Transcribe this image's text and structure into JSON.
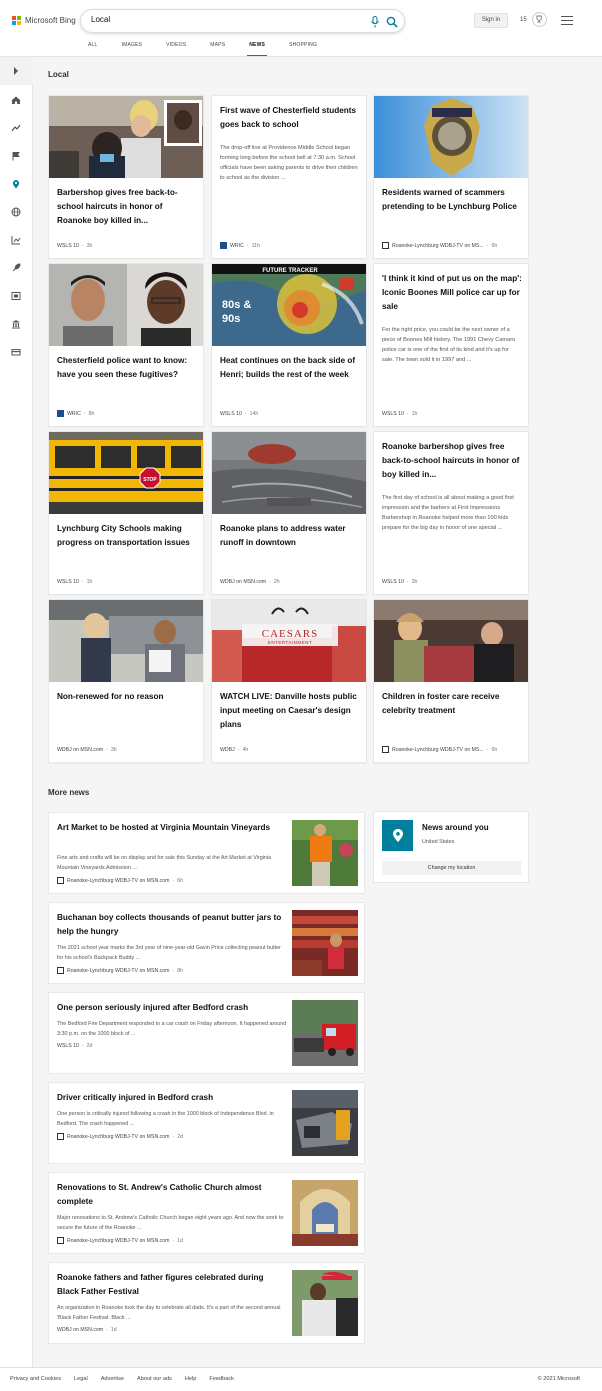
{
  "header": {
    "logo_text": "Microsoft Bing",
    "search_value": "Local",
    "signin_label": "Sign in",
    "rewards_count": "15",
    "tabs": [
      {
        "label": "ALL"
      },
      {
        "label": "IMAGES"
      },
      {
        "label": "VIDEOS"
      },
      {
        "label": "MAPS"
      },
      {
        "label": "NEWS"
      },
      {
        "label": "SHOPPING"
      }
    ]
  },
  "local": {
    "heading": "Local",
    "cards": [
      {
        "title": "Barbershop gives free back-to-school haircuts in honor of Roanoke boy killed in...",
        "snippet": "",
        "source": "WSLS 10",
        "time": "3h"
      },
      {
        "title": "First wave of Chesterfield students goes back to school",
        "snippet": "The drop-off line at Providence Middle School began forming long before the school bell at 7:30 a.m. School officials have been asking parents to drive their children to school as the division ...",
        "source": "WRIC",
        "time": "11h"
      },
      {
        "title": "Residents warned of scammers pretending to be Lynchburg Police",
        "snippet": "",
        "source": "Roanoke-Lynchburg WDBJ-TV on MS...",
        "time": "6h"
      },
      {
        "title": "Chesterfield police want to know: have you seen these fugitives?",
        "snippet": "",
        "source": "WRIC",
        "time": "8h"
      },
      {
        "title": "Heat continues on the back side of Henri; builds the rest of the week",
        "snippet": "",
        "source": "WSLS 10",
        "time": "14h"
      },
      {
        "title": "'I think it kind of put us on the map': Iconic Boones Mill police car up for sale",
        "snippet": "For the right price, you could be the next owner of a piece of Boones Mill history. The 1991 Chevy Camaro police car is one of the first of its kind and it's up for sale. The town sold it in 1997 and ...",
        "source": "WSLS 10",
        "time": "1h"
      },
      {
        "title": "Lynchburg City Schools making progress on transportation issues",
        "snippet": "",
        "source": "WSLS 10",
        "time": "1h"
      },
      {
        "title": "Roanoke plans to address water runoff in downtown",
        "snippet": "",
        "source": "WDBJ on MSN.com",
        "time": "2h"
      },
      {
        "title": "Roanoke barbershop gives free back-to-school haircuts in honor of boy killed in...",
        "snippet": "The first day of school is all about making a good first impression and the barbers at First Impressions Barbershop in Roanoke helped more than 100 kids prepare for the big day in honor of one special ...",
        "source": "WSLS 10",
        "time": "3h"
      },
      {
        "title": "Non-renewed for no reason",
        "snippet": "",
        "source": "WDBJ on MSN.com",
        "time": "3h"
      },
      {
        "title": "WATCH LIVE: Danville hosts public input meeting on Caesar's design plans",
        "snippet": "",
        "source": "WDBJ",
        "time": "4h"
      },
      {
        "title": "Children in foster care receive celebrity treatment",
        "snippet": "",
        "source": "Roanoke-Lynchburg WDBJ-TV on MS...",
        "time": "6h"
      }
    ],
    "image_text": {
      "weather_banner": "FUTURE TRACKER",
      "weather_temp1": "80s &",
      "weather_temp2": "90s",
      "caesars_name": "CAESARS",
      "caesars_sub": "ENTERTAINMENT",
      "bus_stop": "STOP"
    }
  },
  "more_news": {
    "heading": "More news",
    "items": [
      {
        "title": "Art Market to be hosted at Virginia Mountain Vineyards",
        "snippet": "Fine arts and crafts will be on display and for sale this Sunday at the Art Market at Virginia Mountain Vineyards.Admission ...",
        "source": "Roanoke-Lynchburg WDBJ-TV on MSN.com",
        "time": "6h"
      },
      {
        "title": "Buchanan boy collects thousands of peanut butter jars to help the hungry",
        "snippet": "The 2021 school year marks the 3rd year of nine-year-old Gavin Price collecting peanut butter for his school's Backpack Buddy ...",
        "source": "Roanoke-Lynchburg WDBJ-TV on MSN.com",
        "time": "8h"
      },
      {
        "title": "One person seriously injured after Bedford crash",
        "snippet": "The Bedford Fire Department responded to a car crash on Friday afternoon. It happened around 3:30 p.m. on the 1000 block of ...",
        "source": "WSLS 10",
        "time": "2d"
      },
      {
        "title": "Driver critically injured in Bedford crash",
        "snippet": "One person is critically injured following a crash in the 1000 block of Independence Blvd. in Bedford. The crash happened ...",
        "source": "Roanoke-Lynchburg WDBJ-TV on MSN.com",
        "time": "2d"
      },
      {
        "title": "Renovations to St. Andrew's Catholic Church almost complete",
        "snippet": "Major renovations to St. Andrew's Catholic Church began eight years ago. And now the work to secure the future of the Roanoke ...",
        "source": "Roanoke-Lynchburg WDBJ-TV on MSN.com",
        "time": "1d"
      },
      {
        "title": "Roanoke fathers and father figures celebrated during Black Father Festival",
        "snippet": "An organization in Roanoke took the day to celebrate all dads. It's a part of the second annual 'Black Father Festival: Black ...",
        "source": "WDBJ on MSN.com",
        "time": "1d"
      }
    ]
  },
  "news_around": {
    "title": "News around you",
    "country": "United States",
    "button": "Change my location"
  },
  "footer": {
    "links": [
      "Privacy and Cookies",
      "Legal",
      "Advertise",
      "About our ads",
      "Help",
      "Feedback"
    ],
    "copyright": "© 2021 Microsoft"
  },
  "colors": {
    "accent": "#00809d",
    "page_bg": "#f5f5f5"
  }
}
